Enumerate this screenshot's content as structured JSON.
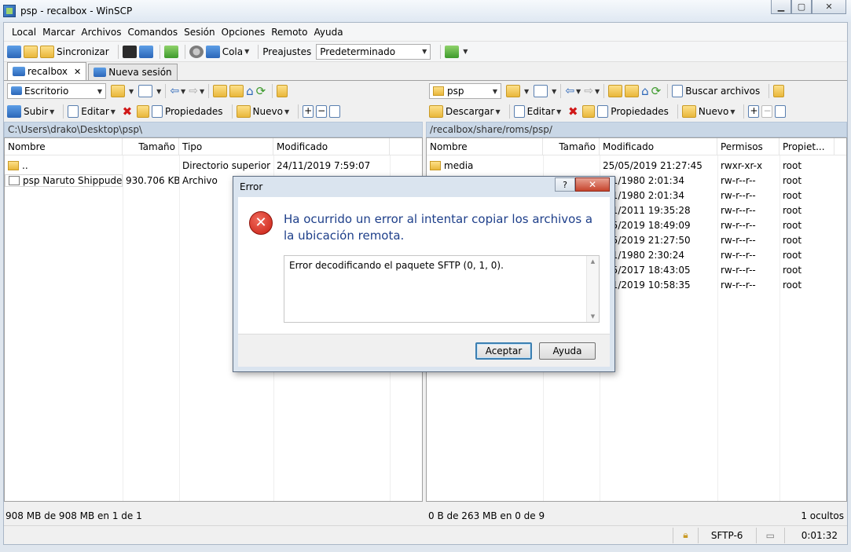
{
  "window": {
    "title": "psp - recalbox - WinSCP"
  },
  "menu": [
    "Local",
    "Marcar",
    "Archivos",
    "Comandos",
    "Sesión",
    "Opciones",
    "Remoto",
    "Ayuda"
  ],
  "toolbar": {
    "sync_label": "Sincronizar",
    "queue_label": "Cola",
    "presets_label": "Preajustes",
    "presets_value": "Predeterminado"
  },
  "tabs": {
    "session": "recalbox",
    "new_session": "Nueva sesión"
  },
  "left_panel": {
    "drive": "Escritorio",
    "upload": "Subir",
    "edit": "Editar",
    "properties": "Propiedades",
    "new": "Nuevo",
    "path": "C:\\Users\\drako\\Desktop\\psp\\",
    "columns": [
      "Nombre",
      "Tamaño",
      "Tipo",
      "Modificado"
    ],
    "rows": [
      {
        "name": "..",
        "size": "",
        "type": "Directorio superior",
        "modified": "24/11/2019  7:59:07"
      },
      {
        "name": "psp Naruto Shippude...",
        "size": "930.706 KB",
        "type": "Archivo",
        "modified": ""
      }
    ],
    "status": "908 MB de 908 MB en 1 de 1"
  },
  "right_panel": {
    "dir": "psp",
    "find_files": "Buscar archivos",
    "download": "Descargar",
    "edit": "Editar",
    "properties": "Propiedades",
    "new": "Nuevo",
    "path": "/recalbox/share/roms/psp/",
    "columns": [
      "Nombre",
      "Tamaño",
      "Modificado",
      "Permisos",
      "Propiet..."
    ],
    "rows": [
      {
        "name": "media",
        "size": "",
        "modified": "25/05/2019 21:27:45",
        "perms": "rwxr-xr-x",
        "owner": "root"
      },
      {
        "name": "",
        "size": "",
        "modified": "/01/1980 2:01:34",
        "perms": "rw-r--r--",
        "owner": "root"
      },
      {
        "name": "",
        "size": "",
        "modified": "/01/1980 2:01:34",
        "perms": "rw-r--r--",
        "owner": "root"
      },
      {
        "name": "",
        "size": "",
        "modified": "/01/2011 19:35:28",
        "perms": "rw-r--r--",
        "owner": "root"
      },
      {
        "name": "",
        "size": "",
        "modified": "/05/2019 18:49:09",
        "perms": "rw-r--r--",
        "owner": "root"
      },
      {
        "name": "",
        "size": "",
        "modified": "/05/2019 21:27:50",
        "perms": "rw-r--r--",
        "owner": "root"
      },
      {
        "name": "",
        "size": "",
        "modified": "/01/1980 2:30:24",
        "perms": "rw-r--r--",
        "owner": "root"
      },
      {
        "name": "",
        "size": "",
        "modified": "/05/2017 18:43:05",
        "perms": "rw-r--r--",
        "owner": "root"
      },
      {
        "name": "",
        "size": "",
        "modified": "/11/2019 10:58:35",
        "perms": "rw-r--r--",
        "owner": "root"
      }
    ],
    "status": "0 B de 263 MB en 0 de 9",
    "hidden": "1 ocultos"
  },
  "statusbar": {
    "protocol": "SFTP-6",
    "time": "0:01:32"
  },
  "dialog": {
    "title": "Error",
    "message": "Ha ocurrido un error al intentar copiar los archivos a la ubicación remota.",
    "detail": "Error decodificando el paquete SFTP (0, 1, 0).",
    "ok": "Aceptar",
    "help": "Ayuda"
  }
}
